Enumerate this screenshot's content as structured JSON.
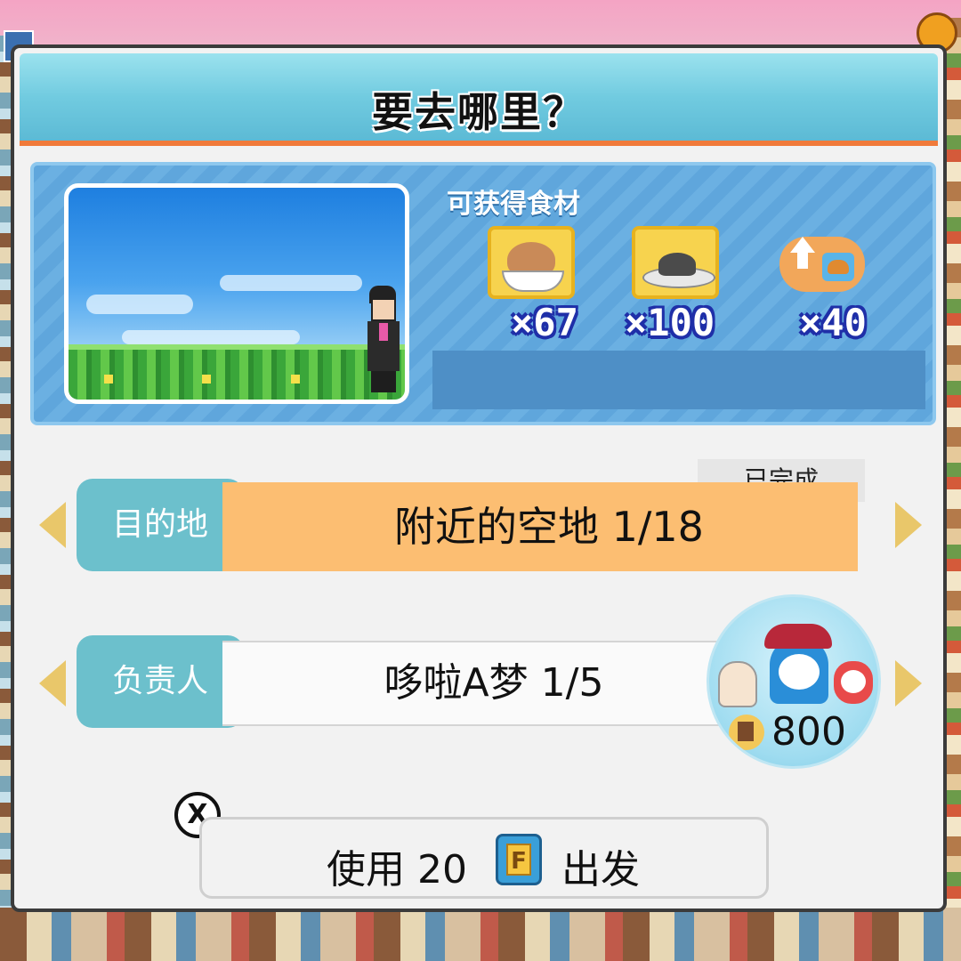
{
  "dialog": {
    "title": "要去哪里？"
  },
  "ingredients": {
    "label": "可获得食材",
    "items": [
      {
        "icon": "rice-bowl-icon",
        "qty": "×67"
      },
      {
        "icon": "dark-dish-icon",
        "qty": "×100"
      },
      {
        "icon": "burger-upgrade-icon",
        "qty": "×40"
      }
    ]
  },
  "destination": {
    "label": "目的地",
    "value": "附近的空地 1/18",
    "status": "已完成"
  },
  "manager": {
    "label": "负责人",
    "value": "哆啦A梦 1/5",
    "cost": "800"
  },
  "footer": {
    "close_icon_label": "X",
    "go_prefix": "使用 20",
    "coin_letter": "F",
    "go_suffix": "出发"
  },
  "colors": {
    "title_bar": "#71cbe0",
    "accent_orange": "#f07a3a",
    "destination_fill": "#fcbe72",
    "label_teal": "#6cc0cc",
    "arrow_gold": "#e9c76a"
  }
}
